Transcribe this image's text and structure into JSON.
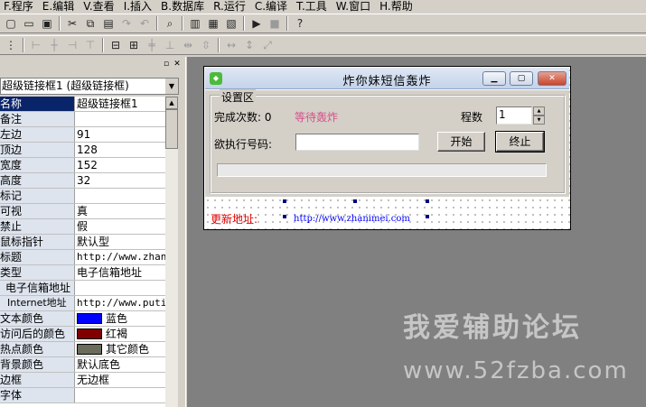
{
  "menu": [
    "F.程序",
    "E.编辑",
    "V.查看",
    "I.插入",
    "B.数据库",
    "R.运行",
    "C.编译",
    "T.工具",
    "W.窗口",
    "H.帮助"
  ],
  "object_selector": "超级链接框1 (超级链接框)",
  "properties": [
    {
      "name": "名称",
      "value": "超级链接框1",
      "selected": true,
      "ellipsis": true
    },
    {
      "name": "备注",
      "value": ""
    },
    {
      "name": "左边",
      "value": "91"
    },
    {
      "name": "顶边",
      "value": "128"
    },
    {
      "name": "宽度",
      "value": "152"
    },
    {
      "name": "高度",
      "value": "32"
    },
    {
      "name": "标记",
      "value": ""
    },
    {
      "name": "可视",
      "value": "真"
    },
    {
      "name": "禁止",
      "value": "假"
    },
    {
      "name": "鼠标指针",
      "value": "默认型"
    },
    {
      "name": "标题",
      "value": "http://www.zhani",
      "mono": true
    },
    {
      "name": "类型",
      "value": "电子信箱地址"
    },
    {
      "name": "电子信箱地址",
      "value": "",
      "indent": 1
    },
    {
      "name": "Internet地址",
      "value": "http://www.putic",
      "mono": true,
      "indent": 2
    },
    {
      "name": "文本颜色",
      "value": "蓝色",
      "color": "#0000ff"
    },
    {
      "name": "访问后的颜色",
      "value": "红褐",
      "color": "#800000"
    },
    {
      "name": "热点颜色",
      "value": "其它颜色",
      "color": "#6b6b5c"
    },
    {
      "name": "背景颜色",
      "value": "默认底色"
    },
    {
      "name": "边框",
      "value": "无边框"
    },
    {
      "name": "字体",
      "value": ""
    }
  ],
  "form": {
    "title": "炸你妹短信轰炸",
    "groupbox_label": "设置区",
    "complete_count_label": "完成次数: 0",
    "status_text": "等待轰炸",
    "thread_label": "程数",
    "thread_value": "1",
    "phone_label": "欲执行号码:",
    "phone_value": "",
    "start_button": "开始",
    "stop_button": "终止",
    "update_label": "更新地址:",
    "update_link": "http://www.zhanimei.com"
  },
  "watermark": {
    "line1": "我爱辅助论坛",
    "line2": "www.52fzba.com"
  }
}
